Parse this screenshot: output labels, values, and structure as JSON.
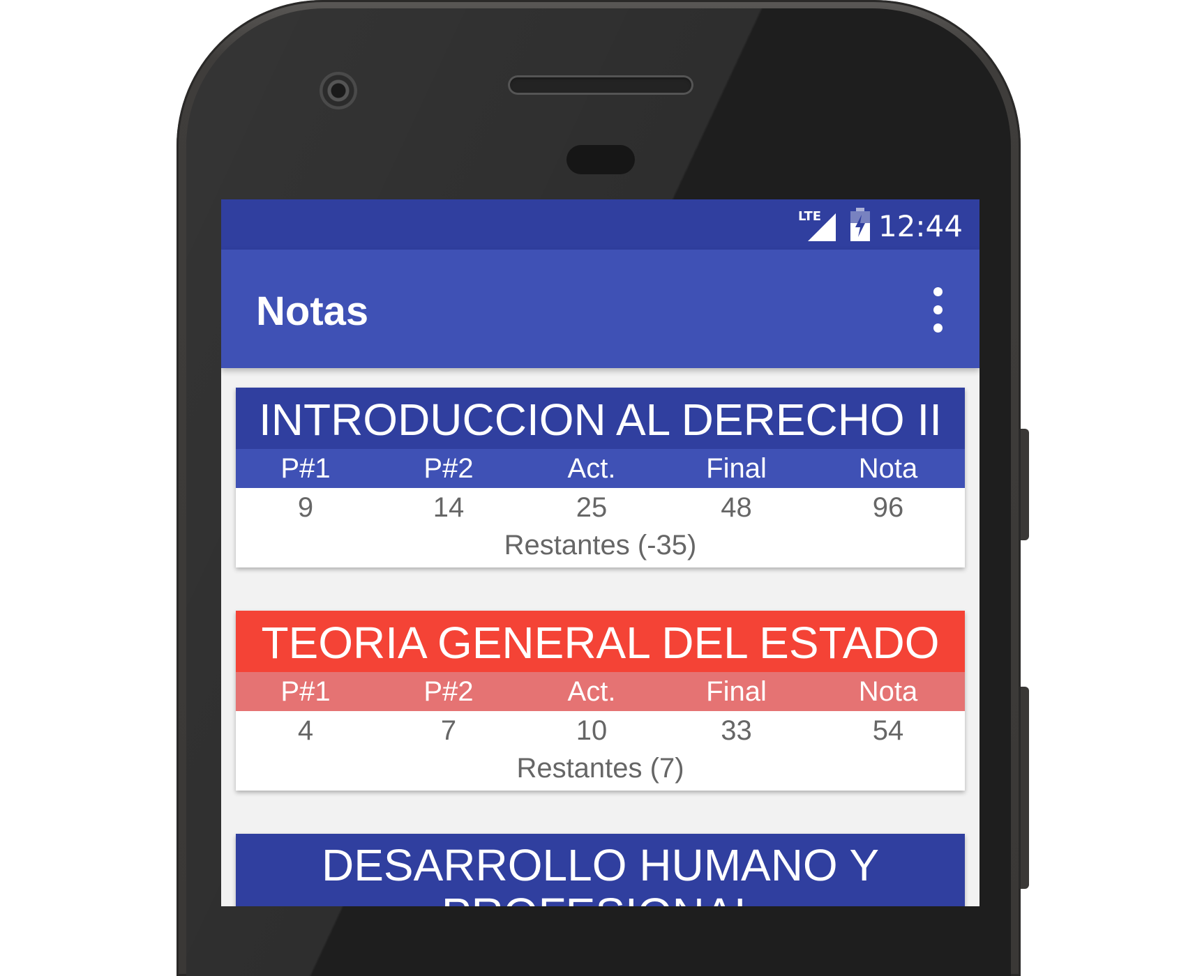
{
  "status_bar": {
    "network": "LTE",
    "time": "12:44"
  },
  "app_bar": {
    "title": "Notas",
    "menu_icon": "more-vert-icon"
  },
  "columns": [
    "P#1",
    "P#2",
    "Act.",
    "Final",
    "Nota"
  ],
  "courses": [
    {
      "name": "INTRODUCCION AL DERECHO II",
      "color": "#303f9f",
      "values": [
        "9",
        "14",
        "25",
        "48",
        "96"
      ],
      "remaining": "Restantes (-35)"
    },
    {
      "name": "TEORIA GENERAL DEL ESTADO",
      "color": "#f44336",
      "values": [
        "4",
        "7",
        "10",
        "33",
        "54"
      ],
      "remaining": "Restantes (7)"
    },
    {
      "name": "DESARROLLO HUMANO Y",
      "name_line2": "PROFESIONAL",
      "color": "#303f9f"
    }
  ],
  "colors": {
    "status_bar": "#303f9f",
    "app_bar": "#3f51b5",
    "red_title": "#f44336",
    "red_header": "#e57373"
  }
}
